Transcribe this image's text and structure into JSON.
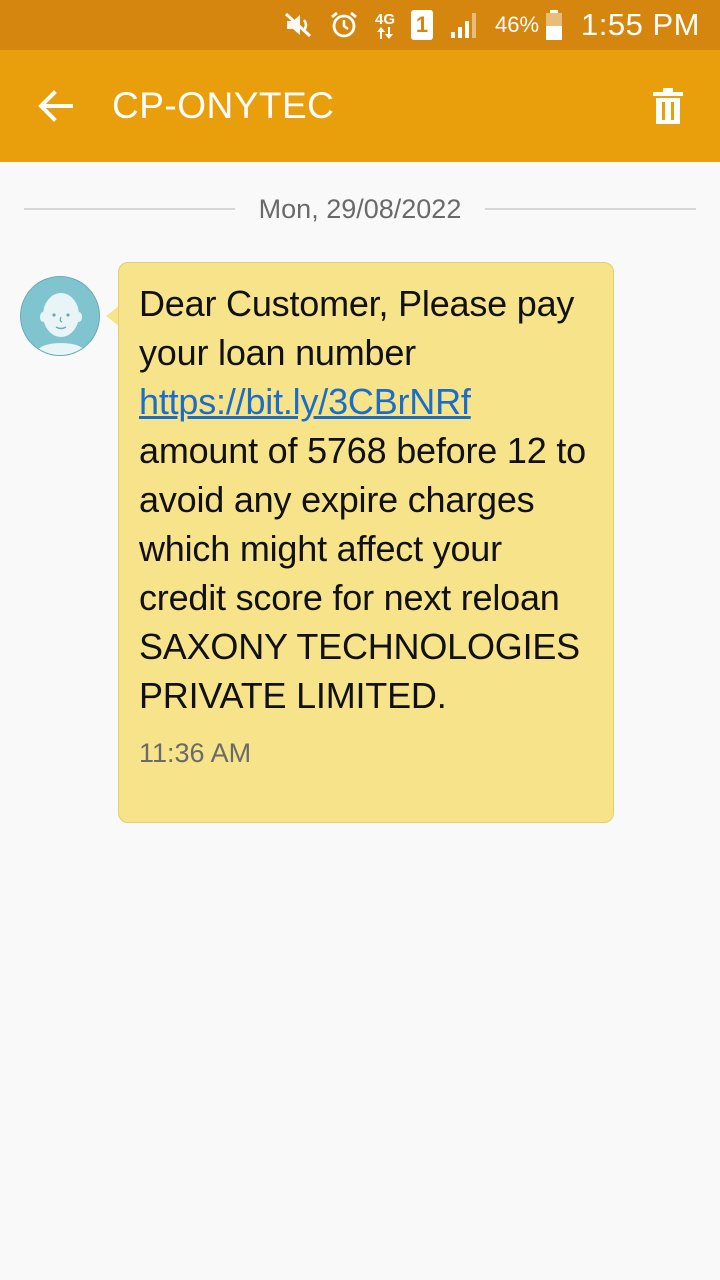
{
  "status_bar": {
    "icons": [
      "mute-icon",
      "alarm-icon",
      "4g-data-icon",
      "sim1-icon",
      "signal-icon",
      "battery-icon"
    ],
    "network_label": "4G",
    "sim_label": "1",
    "battery_percent": "46%",
    "time": "1:55 PM"
  },
  "app_bar": {
    "title": "CP-ONYTEC",
    "back_icon": "back-arrow-icon",
    "delete_icon": "trash-icon"
  },
  "conversation": {
    "date": "Mon, 29/08/2022",
    "message": {
      "text_before": "Dear Customer, Please pay your loan number ",
      "link": "https://bit.ly/3CBrNRf",
      "text_after": " amount of 5768 before 12 to avoid any expire charges which might affect your credit score for next reloan SAXONY TECHNOLOGIES PRIVATE LIMITED.",
      "time": "11:36 AM"
    }
  },
  "colors": {
    "status_bar": "#d5860f",
    "app_bar": "#e89f0b",
    "bubble": "#f6e38a",
    "link": "#1a6dc8",
    "avatar": "#7fc4cf"
  }
}
